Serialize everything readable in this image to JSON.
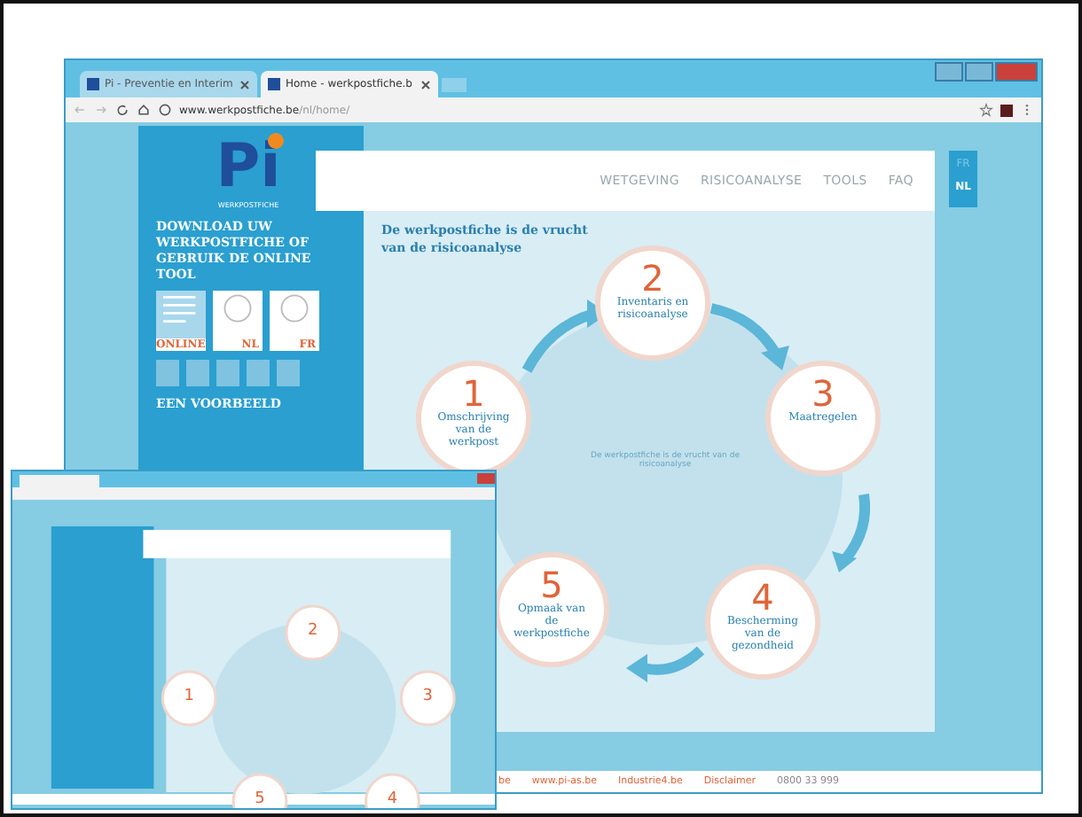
{
  "main_window": {
    "tabs": [
      {
        "label": "Pi - Preventie en Interim",
        "selected": false
      },
      {
        "label": "Home - werkpostfiche.b",
        "selected": true
      }
    ],
    "url": {
      "domain": "www.werkpostfiche.be",
      "path": "/nl/home/"
    },
    "logo": {
      "text": "Pi",
      "subtitle": "WERKPOSTFICHE"
    },
    "sidebar": {
      "heading": "DOWNLOAD UW WERKPOSTFICHE OF GEBRUIK DE ONLINE TOOL",
      "documents": [
        {
          "label": "ONLINE",
          "kind": "form"
        },
        {
          "label": "NL",
          "kind": "disc"
        },
        {
          "label": "FR",
          "kind": "disc"
        }
      ],
      "subheading": "EEN VOORBEELD"
    },
    "nav": [
      "WETGEVING",
      "RISICOANALYSE",
      "TOOLS",
      "FAQ"
    ],
    "languages": [
      {
        "label": "FR",
        "selected": false
      },
      {
        "label": "NL",
        "selected": true
      }
    ],
    "heading": "De werkpostfiche is de vrucht van de risicoanalyse",
    "center_text": "De werkpostfiche is de vrucht van de risicoanalyse",
    "steps": [
      {
        "number": "1",
        "label": "Omschrijving van de werkpost"
      },
      {
        "number": "2",
        "label": "Inventaris en risicoanalyse"
      },
      {
        "number": "3",
        "label": "Maatregelen"
      },
      {
        "number": "4",
        "label": "Bescherming van de gezondheid"
      },
      {
        "number": "5",
        "label": "Opmaak van de werkpostfiche"
      }
    ],
    "footer": [
      "be",
      "www.pi-as.be",
      "Industrie4.be",
      "Disclaimer",
      "0800 33 999"
    ]
  },
  "second_window": {
    "steps": [
      "1",
      "2",
      "3",
      "4",
      "5"
    ]
  }
}
